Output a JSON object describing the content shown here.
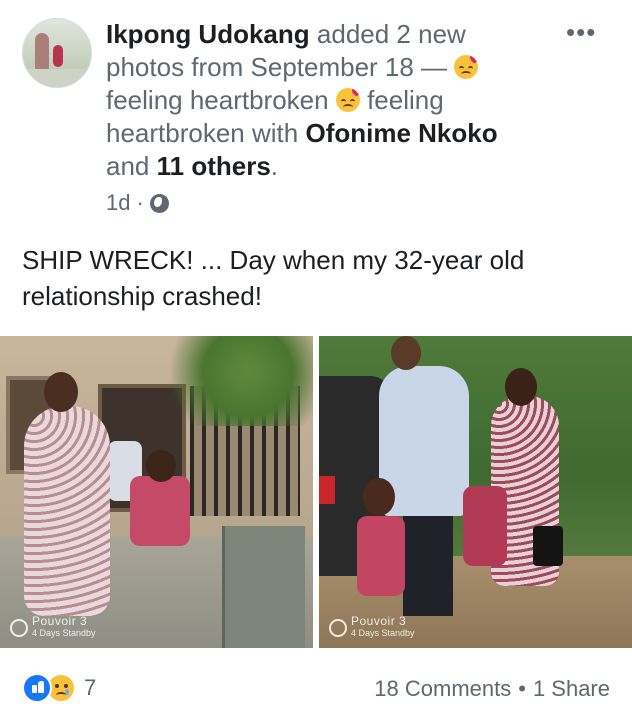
{
  "post": {
    "author": "Ikpong Udokang",
    "action": "added 2 new photos from September 18 —",
    "feeling_1": "feeling heartbroken",
    "feeling_2": "feeling heartbroken with",
    "tagged_person": "Ofonime Nkoko",
    "and_text": "and",
    "others": "11 others",
    "period": ".",
    "time": "1d",
    "dot": "·",
    "privacy_icon": "globe-icon",
    "more_label": "•••",
    "text": "SHIP WRECK! ... Day when my 32-year old relationship crashed!"
  },
  "photos": [
    {
      "watermark_brand": "Pouvoir 3",
      "watermark_sub": "4 Days Standby"
    },
    {
      "watermark_brand": "Pouvoir 3",
      "watermark_sub": "4 Days Standby"
    }
  ],
  "footer": {
    "reaction_icons": [
      "like-icon",
      "sad-icon"
    ],
    "reaction_count": "7",
    "comments": "18 Comments",
    "separator": "•",
    "shares": "1 Share"
  },
  "colors": {
    "link_blue": "#1877f2",
    "secondary_text": "#606770",
    "primary_text": "#1c1e21"
  }
}
